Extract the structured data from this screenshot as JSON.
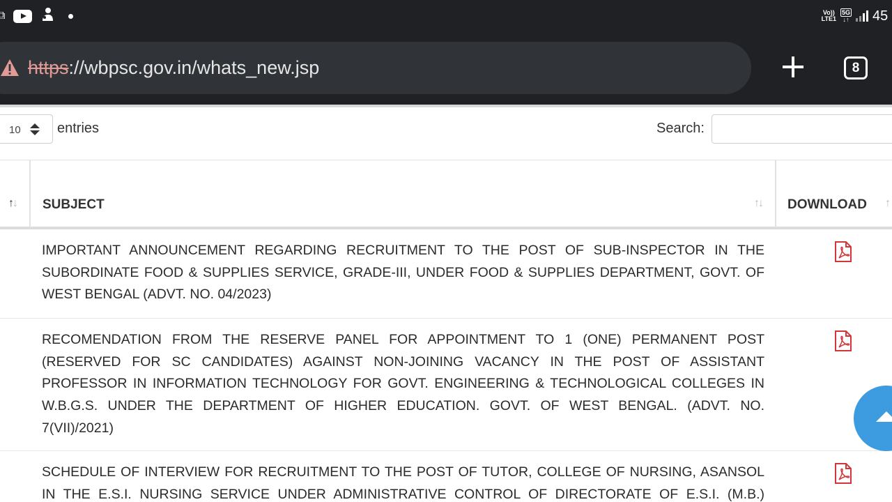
{
  "status_bar": {
    "icons": [
      "screenshot-icon",
      "youtube-icon",
      "notification-icon",
      "dot-icon"
    ],
    "volte_top": "Vo))",
    "volte_bottom": "LTE1",
    "network_top": "5G",
    "network_bottom": "↓↑",
    "battery": "45"
  },
  "browser": {
    "url_scheme": "https",
    "url_rest": "://wbpsc.gov.in/whats_new.jsp",
    "tab_count": "8",
    "warning_color": "#e29a96"
  },
  "table_controls": {
    "length_value": "10",
    "entries_label": "entries",
    "search_label": "Search:",
    "search_value": ""
  },
  "table": {
    "headers": {
      "subject": "SUBJECT",
      "download": "DOWNLOAD"
    },
    "sort_glyph_up": "↑",
    "sort_glyph_down": "↓",
    "rows": [
      {
        "subject": "IMPORTANT ANNOUNCEMENT REGARDING RECRUITMENT TO THE POST OF SUB-INSPECTOR IN THE SUBORDINATE FOOD & SUPPLIES SERVICE, GRADE-III, UNDER FOOD & SUPPLIES DEPARTMENT, GOVT. OF WEST BENGAL (ADVT. NO. 04/2023)",
        "download": "pdf-icon"
      },
      {
        "subject": "RECOMENDATION FROM THE RESERVE PANEL FOR APPOINTMENT TO 1 (ONE) PERMANENT POST (RESERVED FOR SC CANDIDATES) AGAINST NON-JOINING VACANCY IN THE POST OF ASSISTANT PROFESSOR IN INFORMATION TECHNOLOGY FOR GOVT. ENGINEERING & TECHNOLOGICAL COLLEGES IN W.B.G.S. UNDER THE DEPARTMENT OF HIGHER EDUCATION. GOVT. OF WEST BENGAL. (ADVT. NO. 7(VII)/2021)",
        "download": "pdf-icon"
      },
      {
        "subject": "SCHEDULE OF INTERVIEW FOR RECRUITMENT TO THE POST OF TUTOR, COLLEGE OF NURSING, ASANSOL IN THE E.S.I. NURSING SERVICE UNDER ADMINISTRATIVE CONTROL OF DIRECTORATE OF E.S.I. (M.B.) SCHEME",
        "download": "pdf-icon"
      }
    ]
  },
  "colors": {
    "chrome_bg": "#1f2124",
    "url_pill": "#303438",
    "pdf_red": "#d2363a",
    "fab_blue": "#3d9be0"
  }
}
